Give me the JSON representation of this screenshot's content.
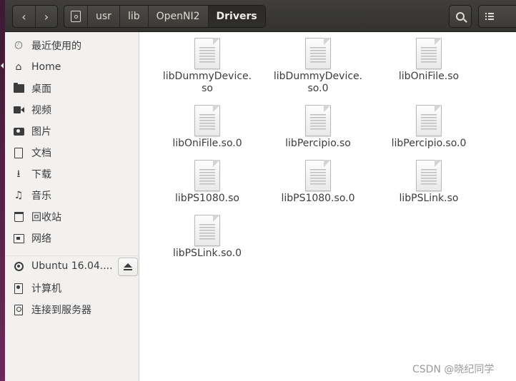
{
  "nav": {
    "back_glyph": "‹",
    "forward_glyph": "›"
  },
  "breadcrumb": {
    "items": [
      "usr",
      "lib",
      "OpenNI2",
      "Drivers"
    ]
  },
  "sidebar": {
    "items": [
      {
        "label": "最近使用的",
        "icon": "clock-icon"
      },
      {
        "label": "Home",
        "icon": "home-icon"
      },
      {
        "label": "桌面",
        "icon": "desktop-folder-icon"
      },
      {
        "label": "视频",
        "icon": "video-icon"
      },
      {
        "label": "图片",
        "icon": "camera-icon"
      },
      {
        "label": "文档",
        "icon": "document-icon"
      },
      {
        "label": "下载",
        "icon": "download-icon"
      },
      {
        "label": "音乐",
        "icon": "music-icon"
      },
      {
        "label": "回收站",
        "icon": "trash-icon"
      },
      {
        "label": "网络",
        "icon": "network-icon"
      }
    ],
    "devices": [
      {
        "label": "Ubuntu 16.04....",
        "icon": "disc-icon"
      },
      {
        "label": "计算机",
        "icon": "computer-icon"
      },
      {
        "label": "连接到服务器",
        "icon": "server-icon"
      }
    ]
  },
  "files": [
    {
      "name": "libDummyDevice.\nso"
    },
    {
      "name": "libDummyDevice.\nso.0"
    },
    {
      "name": "libOniFile.so"
    },
    {
      "name": "libOniFile.so.0"
    },
    {
      "name": "libPercipio.so"
    },
    {
      "name": "libPercipio.so.0"
    },
    {
      "name": "libPS1080.so"
    },
    {
      "name": "libPS1080.so.0"
    },
    {
      "name": "libPSLink.so"
    },
    {
      "name": "libPSLink.so.0"
    }
  ],
  "watermark": "CSDN @晓纪同学"
}
